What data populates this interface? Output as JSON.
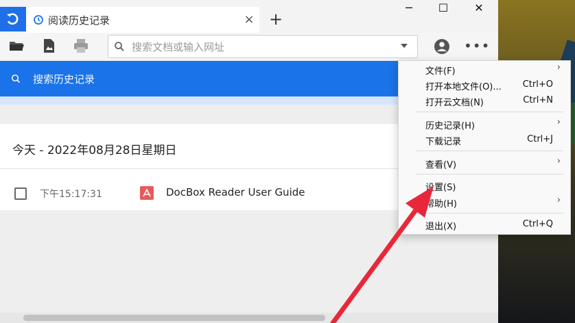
{
  "tab": {
    "title": "阅读历史记录",
    "close": "×"
  },
  "new_tab": "+",
  "window_controls": {
    "minimize": "─",
    "maximize": "☐",
    "close": "✕"
  },
  "address": {
    "placeholder": "搜索文档或输入网址"
  },
  "toolbar_icons": [
    "open-folder-icon",
    "open-image-icon",
    "print-icon",
    "account-icon",
    "more-icon"
  ],
  "history_search": {
    "placeholder": "搜索历史记录"
  },
  "history": {
    "date_header": "今天 - 2022年08月28日星期日",
    "items": [
      {
        "time": "下午15:17:31",
        "file": "DocBox Reader User Guide"
      }
    ]
  },
  "menu": {
    "items": [
      {
        "label": "文件(F)",
        "shortcut": "",
        "submenu": true
      },
      {
        "label": "打开本地文件(O)...",
        "shortcut": "Ctrl+O",
        "submenu": false
      },
      {
        "label": "打开云文档(N)",
        "shortcut": "Ctrl+N",
        "submenu": false
      },
      {
        "label": "历史记录(H)",
        "shortcut": "",
        "submenu": true
      },
      {
        "label": "下载记录",
        "shortcut": "Ctrl+J",
        "submenu": false
      },
      {
        "label": "查看(V)",
        "shortcut": "",
        "submenu": true
      },
      {
        "label": "设置(S)",
        "shortcut": "",
        "submenu": false
      },
      {
        "label": "帮助(H)",
        "shortcut": "",
        "submenu": true
      },
      {
        "label": "退出(X)",
        "shortcut": "Ctrl+Q",
        "submenu": false
      }
    ],
    "submenu_arrow": "›"
  },
  "colors": {
    "accent": "#1a73e8",
    "arrow": "#e8283a",
    "pdf": "#e55b5b"
  }
}
